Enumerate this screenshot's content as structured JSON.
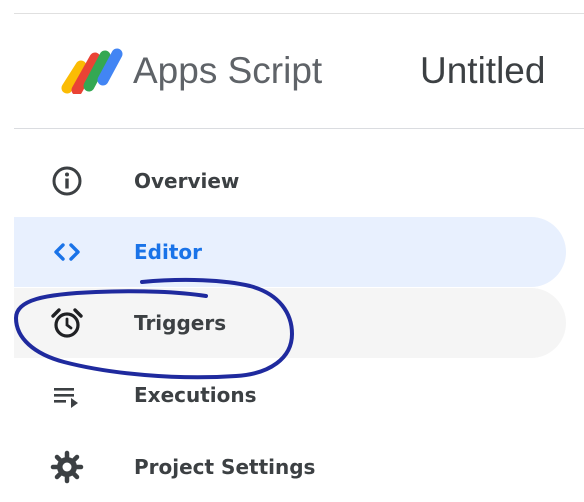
{
  "header": {
    "app_name": "Apps Script",
    "project_title": "Untitled"
  },
  "sidebar": {
    "items": [
      {
        "label": "Overview",
        "icon": "info-icon",
        "state": "normal"
      },
      {
        "label": "Editor",
        "icon": "code-icon",
        "state": "active"
      },
      {
        "label": "Triggers",
        "icon": "alarm-clock-icon",
        "state": "hover"
      },
      {
        "label": "Executions",
        "icon": "executions-icon",
        "state": "normal"
      },
      {
        "label": "Project Settings",
        "icon": "gear-icon",
        "state": "normal"
      }
    ]
  },
  "colors": {
    "active_accent": "#1a73e8",
    "active_background": "#e8f0fe",
    "hover_background": "#f5f5f5",
    "text": "#3c4043",
    "annotation": "#1f2a9e"
  }
}
